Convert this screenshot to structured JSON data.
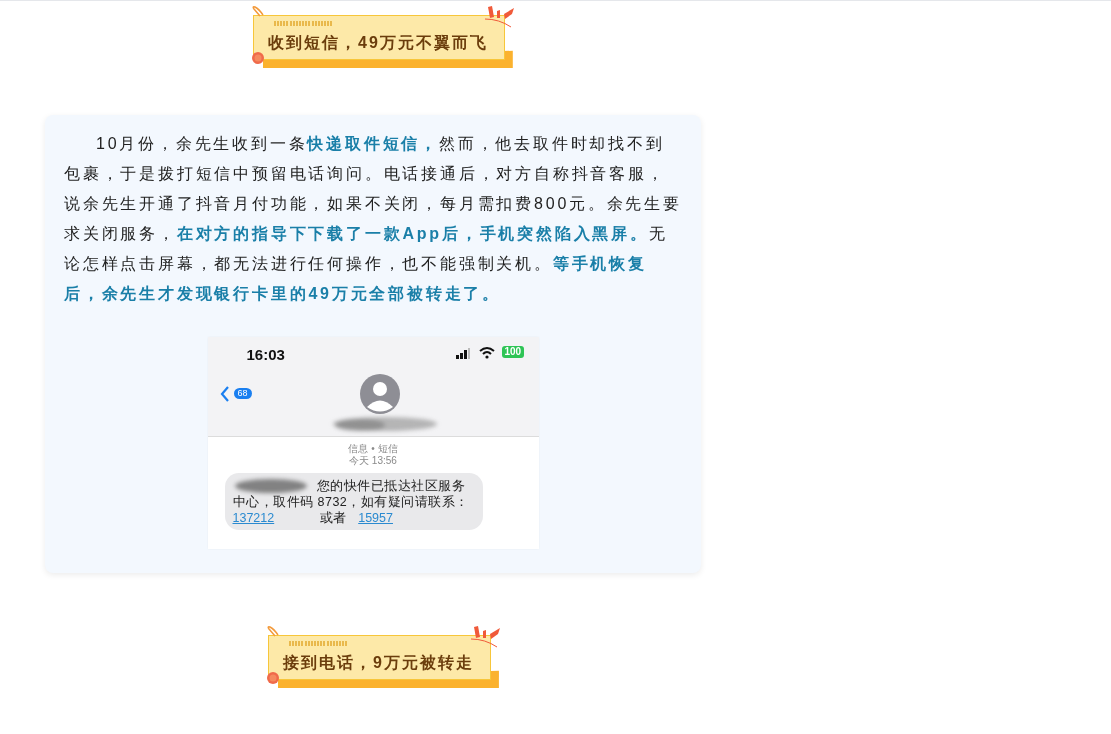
{
  "blocks": [
    {
      "kind": "banner",
      "title": "收到短信，49万元不翼而飞"
    },
    {
      "kind": "card",
      "paragraph": "10月份，余先生收到一条**快递取件短信，**然而，他去取件时却找不到包裹，于是拨打短信中预留电话询问。电话接通后，对方自称抖音客服，说余先生开通了抖音月付功能，如果不关闭，每月需扣费800元。余先生要求关闭服务，**在对方的指导下下载了一款App后，手机突然陷入黑屏。**无论怎样点击屏幕，都无法进行任何操作，也不能强制关机。**等手机恢复后，余先生才发现银行卡里的49万元全部被转走了。**",
      "screenshot": {
        "time": "16:03",
        "back_count": "68",
        "battery": "100",
        "meta": "信息 • 短信",
        "timestamp": "今天 13:56",
        "message_lines": [
          "您的快件已抵达社区服务",
          "中心，取件码 8732，如有疑问请联系："
        ],
        "phone_1": "137212",
        "joiner": "或者",
        "phone_2": "15957"
      }
    },
    {
      "kind": "banner",
      "title": "接到电话，9万元被转走"
    }
  ]
}
